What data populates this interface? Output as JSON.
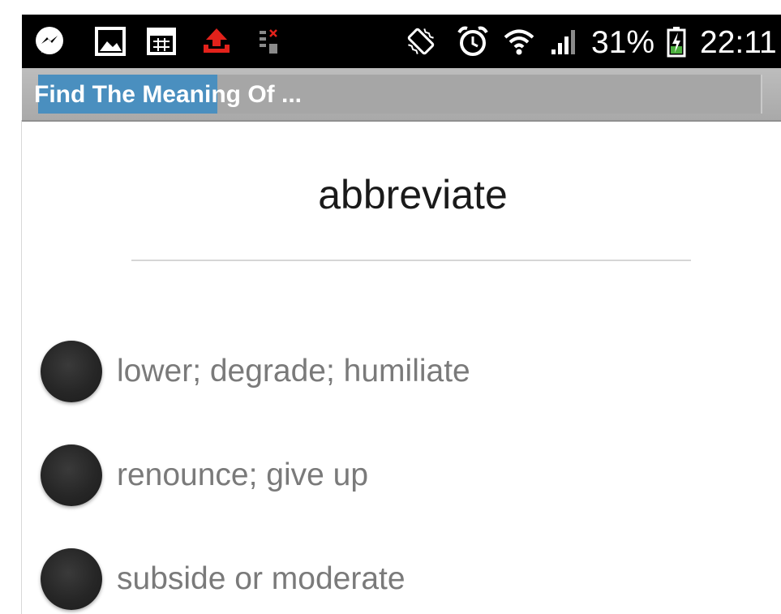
{
  "status_bar": {
    "icons": [
      "messenger-icon",
      "gallery-icon",
      "calendar-icon",
      "upload-icon",
      "sim-icon",
      "vibrate-icon",
      "alarm-icon",
      "wifi-icon",
      "signal-icon",
      "battery-charging-icon"
    ],
    "battery_percent": "31%",
    "time": "22:11",
    "colors": {
      "background": "#000000",
      "upload_icon": "#e3221b"
    }
  },
  "title_bar": {
    "title": "Find The Meaning Of ...",
    "colors": {
      "background": "#b3b3b3",
      "highlight": "#4a8fbf"
    }
  },
  "quiz": {
    "word": "abbreviate",
    "options": [
      {
        "label": "lower; degrade; humiliate",
        "selected": false
      },
      {
        "label": "renounce; give up",
        "selected": false
      },
      {
        "label": "subside or moderate",
        "selected": false
      }
    ]
  }
}
